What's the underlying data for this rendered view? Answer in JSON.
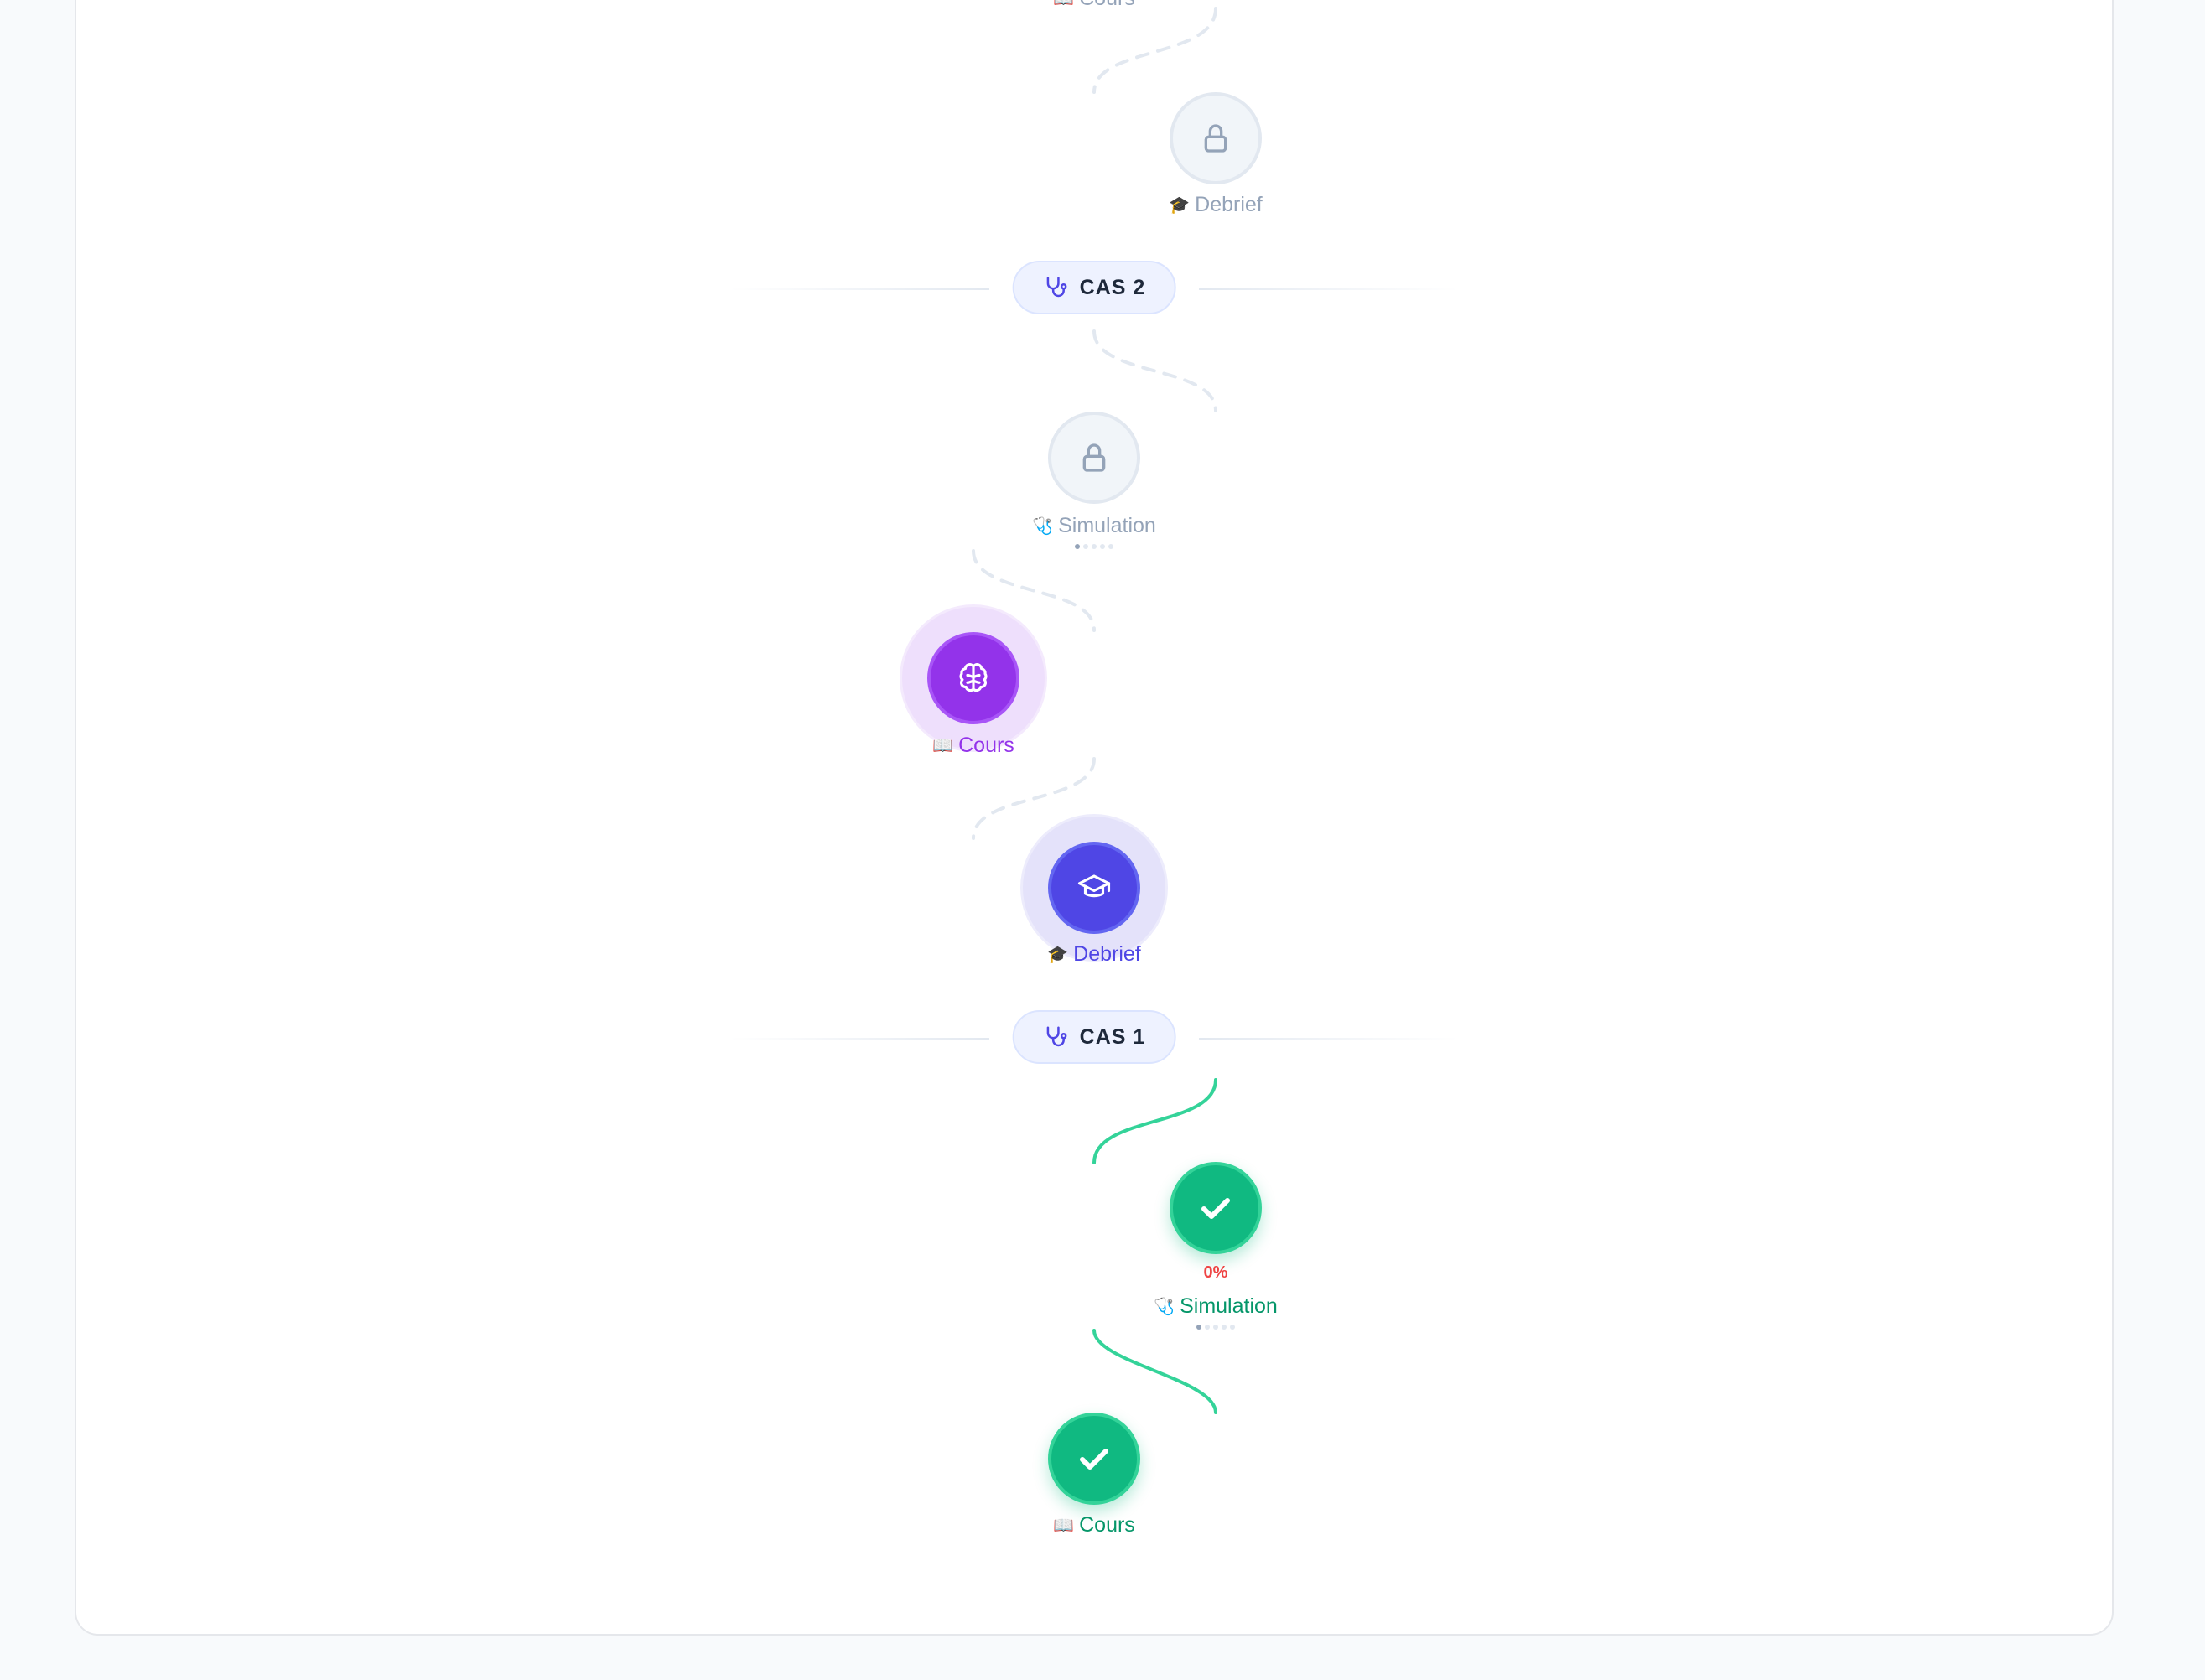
{
  "steps": {
    "top_cours_label": "Cours",
    "cas2_debrief": {
      "label": "Debrief",
      "emoji": "🎓",
      "state": "locked",
      "icon": "lock-icon"
    },
    "cas2_simulation": {
      "label": "Simulation",
      "emoji": "🩺",
      "state": "locked",
      "icon": "lock-icon",
      "progress_dots": 5,
      "dots_filled": 1
    },
    "cas1_cours": {
      "label": "Cours",
      "emoji": "📖",
      "state": "active",
      "icon": "brain-icon"
    },
    "cas1_debrief": {
      "label": "Debrief",
      "emoji": "🎓",
      "state": "active",
      "icon": "graduation-cap-icon"
    },
    "cas1_simulation": {
      "label": "Simulation",
      "emoji": "🩺",
      "state": "completed",
      "icon": "check-icon",
      "score": "0%",
      "progress_dots": 5,
      "dots_filled": 1
    },
    "intro_cours": {
      "label": "Cours",
      "emoji": "📖",
      "state": "completed",
      "icon": "check-icon"
    }
  },
  "sections": {
    "cas2": {
      "label": "CAS 2",
      "icon": "stethoscope-icon"
    },
    "cas1": {
      "label": "CAS 1",
      "icon": "stethoscope-icon"
    }
  },
  "colors": {
    "completed": "#10b981",
    "active_purple": "#9333ea",
    "active_blue": "#4f46e5",
    "locked": "#94a3b8",
    "score_low": "#ef4444"
  }
}
